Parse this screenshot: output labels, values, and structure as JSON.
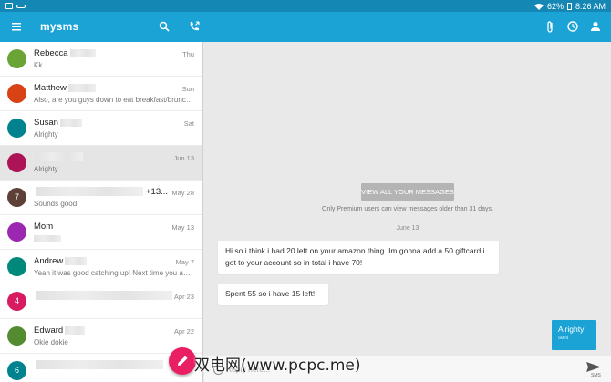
{
  "status": {
    "battery": "62%",
    "time": "8:26 AM"
  },
  "appbar": {
    "title": "mysms",
    "icons": [
      "menu-icon",
      "search-icon",
      "phone-icon",
      "attachment-icon",
      "clock-icon",
      "person-icon"
    ]
  },
  "conversations": [
    {
      "name": "Rebecca",
      "snippet": "Kk",
      "date": "Thu",
      "color": "#6aa436"
    },
    {
      "name": "Matthew",
      "snippet": "Also, are you guys down to eat breakfast/brunch?",
      "date": "Sun",
      "color": "#d84315"
    },
    {
      "name": "Susan",
      "snippet": "Alrighty",
      "date": "Sat",
      "color": "#00838f"
    },
    {
      "name": "",
      "snippet": "Alrighty",
      "date": "Jun 13",
      "color": "#ad1457"
    },
    {
      "avatar": "7",
      "extra": "+13...",
      "snippet": "Sounds good",
      "date": "May 28",
      "color": "#5d4037"
    },
    {
      "name": "Mom",
      "snippet": "",
      "date": "May 13",
      "color": "#9c27b0"
    },
    {
      "name": "Andrew",
      "snippet": "Yeah it was good catching up! Next time you and...",
      "date": "May 7",
      "color": "#00897b"
    },
    {
      "avatar": "4",
      "snippet": "",
      "date": "Apr 23",
      "color": "#d81b60"
    },
    {
      "name": "Edward",
      "snippet": "Okie dokie",
      "date": "Apr 22",
      "color": "#558b2f"
    },
    {
      "avatar": "6",
      "snippet": "",
      "date": "",
      "color": "#00838f"
    }
  ],
  "conversation": {
    "view_all": "VIEW ALL YOUR MESSAGES",
    "premium_notice": "Only Premium users can view messages older than 31 days.",
    "date_separator": "June 13",
    "messages": [
      {
        "text": "Hi so i think i had 20 left on your amazon thing. Im gonna add a 50 giftcard i got to your account so in total i have 70!"
      },
      {
        "text": "Spent 55 so i have 15 left!"
      }
    ],
    "outgoing": {
      "text": "Alrighty",
      "status": "sent"
    },
    "reply_placeholder": "Reply here...",
    "send_label": "SMS"
  },
  "colors": {
    "accent": "#1ba3d6",
    "statusbar": "#1487b4",
    "fab": "#e91e63"
  },
  "watermark": "双电网(www.pcpc.me)"
}
